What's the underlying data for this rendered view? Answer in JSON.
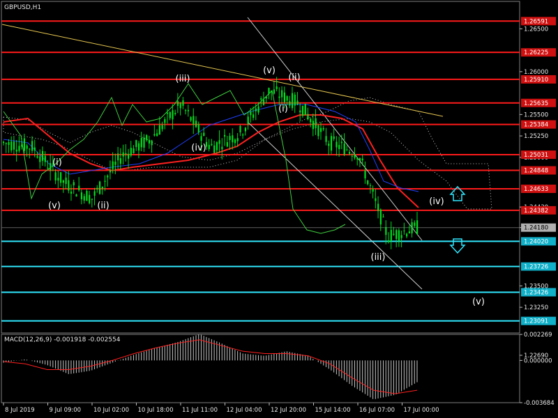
{
  "symbol_title": "GBPUSD,H1",
  "macd_title": "MACD(12,26,9) -0.001918 -0.002554",
  "colors": {
    "background": "#000000",
    "grid": "#303030",
    "price_candles": "#00e020",
    "red_levels": "#ff1a1a",
    "cyan_levels": "#30e8ff",
    "trendline_yellow": "#e8c850",
    "channel_white": "#d0d0d0",
    "ma_red": "#ff2020",
    "ma_blue": "#2040ff",
    "chikou_green": "#40d040",
    "cloud_dots": "#ffffff",
    "macd_hist": "#c8c8c8",
    "macd_signal": "#ff2020",
    "arrow_cyan": "#30e8ff"
  },
  "chart_data": {
    "type": "line",
    "title": "GBPUSD,H1",
    "series": [
      {
        "name": "GBPUSD,H1",
        "x": [
          "8 Jul 2019 00:00",
          "8 Jul 12:00",
          "9 Jul 00:00",
          "9 Jul 12:00",
          "10 Jul 00:00",
          "10 Jul 12:00",
          "11 Jul 00:00",
          "11 Jul 12:00",
          "12 Jul 00:00",
          "12 Jul 12:00",
          "15 Jul 00:00",
          "15 Jul 12:00",
          "16 Jul 00:00",
          "16 Jul 12:00",
          "17 Jul 00:00"
        ],
        "values": [
          1.2517,
          1.2512,
          1.2472,
          1.2452,
          1.2502,
          1.2522,
          1.2562,
          1.2512,
          1.2528,
          1.2578,
          1.2563,
          1.2518,
          1.2505,
          1.2408,
          1.2418
        ]
      }
    ],
    "price_axis": {
      "ticks": [
        "1.26500",
        "1.26000",
        "1.25500",
        "1.25250",
        "1.25000",
        "1.24420",
        "1.24180",
        "1.23500",
        "1.23250",
        "1.22690"
      ],
      "ylim": [
        1.2295,
        1.2682
      ]
    },
    "time_axis": {
      "ticks": [
        "8 Jul 2019",
        "9 Jul 09:00",
        "10 Jul 02:00",
        "10 Jul 18:00",
        "11 Jul 11:00",
        "12 Jul 04:00",
        "12 Jul 20:00",
        "15 Jul 14:00",
        "16 Jul 07:00",
        "17 Jul 00:00"
      ]
    },
    "levels": [
      {
        "price": 1.2659,
        "label": "1.26591",
        "color": "red"
      },
      {
        "price": 1.26225,
        "label": "1.26225",
        "color": "red"
      },
      {
        "price": 1.2591,
        "label": "1.25910",
        "color": "red"
      },
      {
        "price": 1.25635,
        "label": "1.25635",
        "color": "red"
      },
      {
        "price": 1.25384,
        "label": "1.25384",
        "color": "red"
      },
      {
        "price": 1.25031,
        "label": "1.25031",
        "color": "red"
      },
      {
        "price": 1.24848,
        "label": "1.24848",
        "color": "red"
      },
      {
        "price": 1.24633,
        "label": "1.24633",
        "color": "red"
      },
      {
        "price": 1.24382,
        "label": "1.24382",
        "color": "red"
      },
      {
        "price": 1.2402,
        "label": "1.24020",
        "color": "cyan"
      },
      {
        "price": 1.23726,
        "label": "1.23726",
        "color": "cyan"
      },
      {
        "price": 1.23426,
        "label": "1.23426",
        "color": "cyan"
      },
      {
        "price": 1.23091,
        "label": "1.23091",
        "color": "cyan"
      }
    ],
    "current_price_label": "1.24180",
    "wave_labels": [
      "(i)",
      "(v)",
      "(ii)",
      "(iii)",
      "(iv)",
      "(v)",
      "(ii)",
      "(i)",
      "(iii)",
      "(iv)",
      "(v)"
    ],
    "macd": {
      "title": "MACD(12,26,9) -0.001918 -0.002554",
      "ticks": [
        "0.002269",
        "0.000000",
        "-0.003684"
      ],
      "ylim": [
        -0.003684,
        0.002269
      ],
      "histogram": [
        -0.0002,
        0.0001,
        -0.0004,
        -0.0012,
        -0.0009,
        -0.0002,
        0.0005,
        0.0011,
        0.0016,
        0.0023,
        0.0015,
        0.0006,
        0.0004,
        0.0008,
        0.0004,
        -0.0008,
        -0.0022,
        -0.0034,
        -0.003,
        -0.0019
      ],
      "signal": [
        -0.0001,
        -0.0003,
        -0.0008,
        -0.0008,
        -0.0005,
        0.0,
        0.0006,
        0.0011,
        0.0015,
        0.0018,
        0.0013,
        0.0008,
        0.0006,
        0.0006,
        0.0004,
        -0.0003,
        -0.0015,
        -0.0026,
        -0.0029,
        -0.0026
      ]
    }
  }
}
